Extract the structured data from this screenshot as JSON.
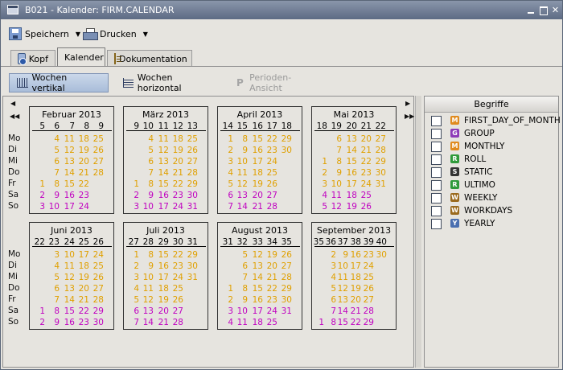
{
  "window": {
    "title": "B021 - Kalender: FIRM.CALENDAR"
  },
  "toolbar": {
    "save_label": "Speichern",
    "print_label": "Drucken"
  },
  "tabs": [
    {
      "label": "Kopf"
    },
    {
      "label": "Kalender"
    },
    {
      "label": "Dokumentation"
    }
  ],
  "view_buttons": [
    {
      "label": "Wochen vertikal"
    },
    {
      "label": "Wochen horizontal"
    },
    {
      "label": "Perioden-Ansicht"
    }
  ],
  "weekdays": [
    "Mo",
    "Di",
    "Mi",
    "Do",
    "Fr",
    "Sa",
    "So"
  ],
  "colors": {
    "workday": "#e0a000",
    "weekend": "#c000c0",
    "other": "#e0a000",
    "selected_tab": "#a9bdd9"
  },
  "months": [
    {
      "title": "Februar 2013",
      "weeks": [
        "5",
        "6",
        "7",
        "8",
        "9"
      ],
      "rows": [
        [
          "",
          "4",
          "11",
          "18",
          "25"
        ],
        [
          "",
          "5",
          "12",
          "19",
          "26"
        ],
        [
          "",
          "6",
          "13",
          "20",
          "27"
        ],
        [
          "",
          "7",
          "14",
          "21",
          "28"
        ],
        [
          "1",
          "8",
          "15",
          "22",
          ""
        ],
        [
          "2",
          "9",
          "16",
          "23",
          ""
        ],
        [
          "3",
          "10",
          "17",
          "24",
          ""
        ]
      ]
    },
    {
      "title": "März 2013",
      "weeks": [
        "9",
        "10",
        "11",
        "12",
        "13"
      ],
      "rows": [
        [
          "",
          "4",
          "11",
          "18",
          "25"
        ],
        [
          "",
          "5",
          "12",
          "19",
          "26"
        ],
        [
          "",
          "6",
          "13",
          "20",
          "27"
        ],
        [
          "",
          "7",
          "14",
          "21",
          "28"
        ],
        [
          "1",
          "8",
          "15",
          "22",
          "29"
        ],
        [
          "2",
          "9",
          "16",
          "23",
          "30"
        ],
        [
          "3",
          "10",
          "17",
          "24",
          "31"
        ]
      ]
    },
    {
      "title": "April 2013",
      "weeks": [
        "14",
        "15",
        "16",
        "17",
        "18"
      ],
      "rows": [
        [
          "1",
          "8",
          "15",
          "22",
          "29"
        ],
        [
          "2",
          "9",
          "16",
          "23",
          "30"
        ],
        [
          "3",
          "10",
          "17",
          "24",
          ""
        ],
        [
          "4",
          "11",
          "18",
          "25",
          ""
        ],
        [
          "5",
          "12",
          "19",
          "26",
          ""
        ],
        [
          "6",
          "13",
          "20",
          "27",
          ""
        ],
        [
          "7",
          "14",
          "21",
          "28",
          ""
        ]
      ]
    },
    {
      "title": "Mai 2013",
      "weeks": [
        "18",
        "19",
        "20",
        "21",
        "22"
      ],
      "rows": [
        [
          "",
          "6",
          "13",
          "20",
          "27"
        ],
        [
          "",
          "7",
          "14",
          "21",
          "28"
        ],
        [
          "1",
          "8",
          "15",
          "22",
          "29"
        ],
        [
          "2",
          "9",
          "16",
          "23",
          "30"
        ],
        [
          "3",
          "10",
          "17",
          "24",
          "31"
        ],
        [
          "4",
          "11",
          "18",
          "25",
          ""
        ],
        [
          "5",
          "12",
          "19",
          "26",
          ""
        ]
      ]
    },
    {
      "title": "Juni 2013",
      "weeks": [
        "22",
        "23",
        "24",
        "25",
        "26"
      ],
      "rows": [
        [
          "",
          "3",
          "10",
          "17",
          "24"
        ],
        [
          "",
          "4",
          "11",
          "18",
          "25"
        ],
        [
          "",
          "5",
          "12",
          "19",
          "26"
        ],
        [
          "",
          "6",
          "13",
          "20",
          "27"
        ],
        [
          "",
          "7",
          "14",
          "21",
          "28"
        ],
        [
          "1",
          "8",
          "15",
          "22",
          "29"
        ],
        [
          "2",
          "9",
          "16",
          "23",
          "30"
        ]
      ]
    },
    {
      "title": "Juli 2013",
      "weeks": [
        "27",
        "28",
        "29",
        "30",
        "31"
      ],
      "rows": [
        [
          "1",
          "8",
          "15",
          "22",
          "29"
        ],
        [
          "2",
          "9",
          "16",
          "23",
          "30"
        ],
        [
          "3",
          "10",
          "17",
          "24",
          "31"
        ],
        [
          "4",
          "11",
          "18",
          "25",
          ""
        ],
        [
          "5",
          "12",
          "19",
          "26",
          ""
        ],
        [
          "6",
          "13",
          "20",
          "27",
          ""
        ],
        [
          "7",
          "14",
          "21",
          "28",
          ""
        ]
      ]
    },
    {
      "title": "August 2013",
      "weeks": [
        "31",
        "32",
        "33",
        "34",
        "35"
      ],
      "rows": [
        [
          "",
          "5",
          "12",
          "19",
          "26"
        ],
        [
          "",
          "6",
          "13",
          "20",
          "27"
        ],
        [
          "",
          "7",
          "14",
          "21",
          "28"
        ],
        [
          "1",
          "8",
          "15",
          "22",
          "29"
        ],
        [
          "2",
          "9",
          "16",
          "23",
          "30"
        ],
        [
          "3",
          "10",
          "17",
          "24",
          "31"
        ],
        [
          "4",
          "11",
          "18",
          "25",
          ""
        ]
      ]
    },
    {
      "title": "September 2013",
      "weeks": [
        "35",
        "36",
        "37",
        "38",
        "39",
        "40"
      ],
      "rows": [
        [
          "",
          "2",
          "9",
          "16",
          "23",
          "30"
        ],
        [
          "",
          "3",
          "10",
          "17",
          "24",
          ""
        ],
        [
          "",
          "4",
          "11",
          "18",
          "25",
          ""
        ],
        [
          "",
          "5",
          "12",
          "19",
          "26",
          ""
        ],
        [
          "",
          "6",
          "13",
          "20",
          "27",
          ""
        ],
        [
          "",
          "7",
          "14",
          "21",
          "28",
          ""
        ],
        [
          "1",
          "8",
          "15",
          "22",
          "29",
          ""
        ]
      ]
    }
  ],
  "begriffe": {
    "header": "Begriffe",
    "items": [
      {
        "badge": "M",
        "color": "#e08a1e",
        "label": "FIRST_DAY_OF_MONTH"
      },
      {
        "badge": "G",
        "color": "#8e3ab8",
        "label": "GROUP"
      },
      {
        "badge": "M",
        "color": "#e08a1e",
        "label": "MONTHLY"
      },
      {
        "badge": "R",
        "color": "#2f9a3a",
        "label": "ROLL"
      },
      {
        "badge": "S",
        "color": "#333333",
        "label": "STATIC"
      },
      {
        "badge": "R",
        "color": "#2f9a3a",
        "label": "ULTIMO"
      },
      {
        "badge": "W",
        "color": "#9a6a1e",
        "label": "WEEKLY"
      },
      {
        "badge": "W",
        "color": "#9a6a1e",
        "label": "WORKDAYS"
      },
      {
        "badge": "Y",
        "color": "#4a6fb0",
        "label": "YEARLY"
      }
    ]
  }
}
